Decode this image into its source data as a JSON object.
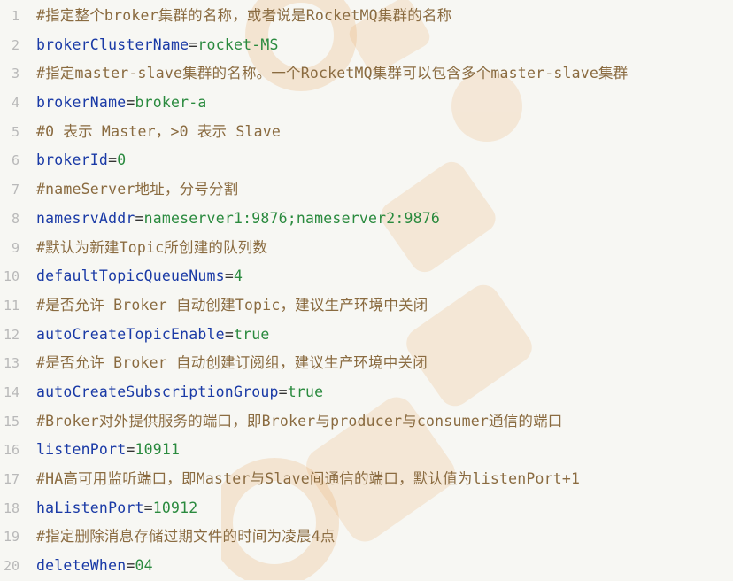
{
  "colors": {
    "comment": "#8a6b40",
    "key": "#1a3aa6",
    "value": "#2a8a3e",
    "line_number": "#b9b9b9",
    "background": "#f7f7f3",
    "watermark": "#e9a35a"
  },
  "watermark_icon": "brand-logo-watermark",
  "lines": [
    {
      "number": "1",
      "comment": "#指定整个broker集群的名称，或者说是RocketMQ集群的名称"
    },
    {
      "number": "2",
      "key": "brokerClusterName",
      "eq": "=",
      "value": "rocket-MS"
    },
    {
      "number": "3",
      "comment": "#指定master-slave集群的名称。一个RocketMQ集群可以包含多个master-slave集群"
    },
    {
      "number": "4",
      "key": "brokerName",
      "eq": "=",
      "value": "broker-a"
    },
    {
      "number": "5",
      "comment": "#0 表示 Master，>0 表示 Slave"
    },
    {
      "number": "6",
      "key": "brokerId",
      "eq": "=",
      "value": "0"
    },
    {
      "number": "7",
      "comment": "#nameServer地址，分号分割"
    },
    {
      "number": "8",
      "key": "namesrvAddr",
      "eq": "=",
      "value": "nameserver1:9876;nameserver2:9876"
    },
    {
      "number": "9",
      "comment": "#默认为新建Topic所创建的队列数"
    },
    {
      "number": "10",
      "key": "defaultTopicQueueNums",
      "eq": "=",
      "value": "4"
    },
    {
      "number": "11",
      "comment": "#是否允许 Broker 自动创建Topic，建议生产环境中关闭"
    },
    {
      "number": "12",
      "key": "autoCreateTopicEnable",
      "eq": "=",
      "value": "true"
    },
    {
      "number": "13",
      "comment": "#是否允许 Broker 自动创建订阅组，建议生产环境中关闭"
    },
    {
      "number": "14",
      "key": "autoCreateSubscriptionGroup",
      "eq": "=",
      "value": "true"
    },
    {
      "number": "15",
      "comment": "#Broker对外提供服务的端口，即Broker与producer与consumer通信的端口"
    },
    {
      "number": "16",
      "key": "listenPort",
      "eq": "=",
      "value": "10911"
    },
    {
      "number": "17",
      "comment": "#HA高可用监听端口，即Master与Slave间通信的端口，默认值为listenPort+1"
    },
    {
      "number": "18",
      "key": "haListenPort",
      "eq": "=",
      "value": "10912"
    },
    {
      "number": "19",
      "comment": "#指定删除消息存储过期文件的时间为凌晨4点"
    },
    {
      "number": "20",
      "key": "deleteWhen",
      "eq": "=",
      "value": "04"
    }
  ]
}
